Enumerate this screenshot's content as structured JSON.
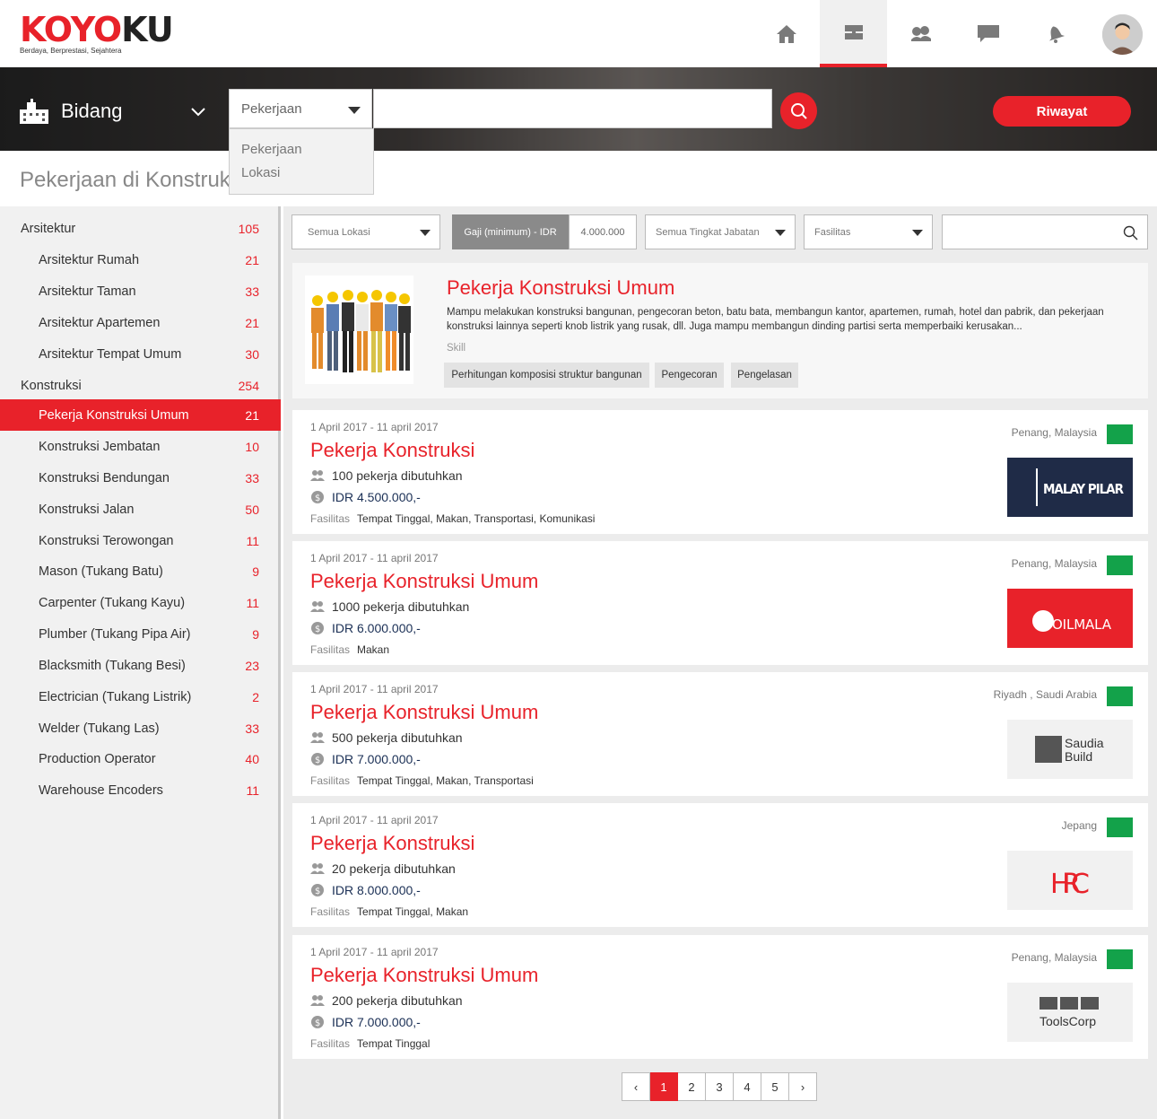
{
  "brand": {
    "logo_red": "KOYO",
    "logo_dark": "KU",
    "tagline": "Berdaya, Berprestasi, Sejahtera",
    "accent": "#e8222a"
  },
  "nav": {
    "icons": [
      "home-icon",
      "briefcase-icon",
      "people-icon",
      "chat-icon",
      "bell-icon",
      "avatar"
    ],
    "active": "briefcase-icon"
  },
  "search": {
    "bidang_label": "Bidang",
    "select_value": "Pekerjaan",
    "options": [
      "Pekerjaan",
      "Lokasi"
    ],
    "history_button": "Riwayat"
  },
  "page_title": "Pekerjaan di Konstruksi",
  "sidebar": {
    "items": [
      {
        "label": "Arsitektur",
        "count": "105",
        "level": 0
      },
      {
        "label": "Arsitektur Rumah",
        "count": "21",
        "level": 1
      },
      {
        "label": "Arsitektur Taman",
        "count": "33",
        "level": 1
      },
      {
        "label": "Arsitektur Apartemen",
        "count": "21",
        "level": 1
      },
      {
        "label": "Arsitektur Tempat Umum",
        "count": "30",
        "level": 1
      },
      {
        "label": "Konstruksi",
        "count": "254",
        "level": 0
      },
      {
        "label": "Pekerja Konstruksi Umum",
        "count": "21",
        "level": 1,
        "active": true
      },
      {
        "label": "Konstruksi Jembatan",
        "count": "10",
        "level": 1
      },
      {
        "label": "Konstruksi Bendungan",
        "count": "33",
        "level": 1
      },
      {
        "label": "Konstruksi Jalan",
        "count": "50",
        "level": 1
      },
      {
        "label": "Konstruksi Terowongan",
        "count": "11",
        "level": 1
      },
      {
        "label": "Mason (Tukang Batu)",
        "count": "9",
        "level": 1
      },
      {
        "label": "Carpenter (Tukang Kayu)",
        "count": "11",
        "level": 1
      },
      {
        "label": "Plumber (Tukang Pipa Air)",
        "count": "9",
        "level": 1
      },
      {
        "label": "Blacksmith (Tukang Besi)",
        "count": "23",
        "level": 1
      },
      {
        "label": "Electrician (Tukang Listrik)",
        "count": "2",
        "level": 1
      },
      {
        "label": "Welder (Tukang Las)",
        "count": "33",
        "level": 1
      },
      {
        "label": "Production Operator",
        "count": "40",
        "level": 1
      },
      {
        "label": "Warehouse Encoders",
        "count": "11",
        "level": 1
      }
    ]
  },
  "filters": {
    "location": "Semua Lokasi",
    "salary_label": "Gaji (minimum) - IDR",
    "salary_value": "4.000.000",
    "position": "Semua Tingkat Jabatan",
    "facility": "Fasilitas"
  },
  "featured": {
    "title": "Pekerja Konstruksi Umum",
    "description": "Mampu melakukan konstruksi bangunan, pengecoran beton, batu bata, membangun kantor,  apartemen, rumah, hotel dan pabrik, dan pekerjaan konstruksi lainnya seperti knob listrik yang rusak, dll. Juga mampu membangun dinding partisi serta memperbaiki kerusakan...",
    "skill_label": "Skill",
    "skills": [
      "Perhitungan komposisi struktur bangunan",
      "Pengecoran",
      "Pengelasan"
    ]
  },
  "jobs": [
    {
      "date": "1 April 2017 - 11 april 2017",
      "title": "Pekerja Konstruksi",
      "need": "100 pekerja dibutuhkan",
      "salary": "IDR 4.500.000,-",
      "fac_label": "Fasilitas",
      "facilities": "Tempat Tinggal, Makan, Transportasi, Komunikasi",
      "location": "Penang, Malaysia",
      "logo": "MALAY PILAR"
    },
    {
      "date": "1 April 2017 - 11 april 2017",
      "title": "Pekerja Konstruksi Umum",
      "need": "1000 pekerja dibutuhkan",
      "salary": "IDR 6.000.000,-",
      "fac_label": "Fasilitas",
      "facilities": "Makan",
      "location": "Penang, Malaysia",
      "logo": "OILMALA"
    },
    {
      "date": "1 April 2017 - 11 april 2017",
      "title": "Pekerja Konstruksi Umum",
      "need": "500 pekerja dibutuhkan",
      "salary": "IDR 7.000.000,-",
      "fac_label": "Fasilitas",
      "facilities": "Tempat Tinggal, Makan, Transportasi",
      "location": "Riyadh , Saudi Arabia",
      "logo": "Saudia Build"
    },
    {
      "date": "1 April 2017 - 11 april 2017",
      "title": "Pekerja Konstruksi",
      "need": "20 pekerja dibutuhkan",
      "salary": "IDR 8.000.000,-",
      "fac_label": "Fasilitas",
      "facilities": "Tempat Tinggal, Makan",
      "location": "Jepang",
      "logo": "HRC"
    },
    {
      "date": "1 April 2017 - 11 april 2017",
      "title": "Pekerja Konstruksi Umum",
      "need": "200 pekerja dibutuhkan",
      "salary": "IDR 7.000.000,-",
      "fac_label": "Fasilitas",
      "facilities": "Tempat Tinggal",
      "location": "Penang, Malaysia",
      "logo": "ToolsCorp"
    }
  ],
  "pagination": {
    "prev": "‹",
    "pages": [
      "1",
      "2",
      "3",
      "4",
      "5"
    ],
    "current": "1",
    "next": "›"
  }
}
